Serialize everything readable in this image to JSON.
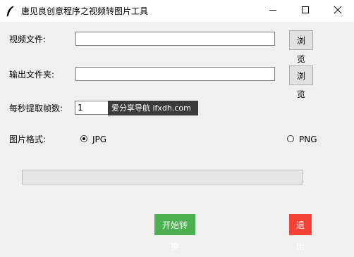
{
  "window": {
    "title": "唐见良创意程序之视频转图片工具",
    "icon": "feather-icon"
  },
  "video_file": {
    "label": "视频文件:",
    "value": "",
    "browse_label": "浏览"
  },
  "output_folder": {
    "label": "输出文件夹:",
    "value": "",
    "browse_label": "浏览"
  },
  "fps": {
    "label": "每秒提取帧数:",
    "value": "1"
  },
  "watermark": {
    "text": "爱分享导航 ifxdh.com"
  },
  "image_format": {
    "label": "图片格式:",
    "options": [
      {
        "label": "JPG",
        "selected": true
      },
      {
        "label": "PNG",
        "selected": false
      }
    ]
  },
  "progress": {
    "value": 0
  },
  "actions": {
    "start_label": "开始转换",
    "quit_label": "退出"
  },
  "colors": {
    "start_button": "#4caf50",
    "quit_button": "#f44336",
    "watermark_bg": "#3a3a3a"
  }
}
